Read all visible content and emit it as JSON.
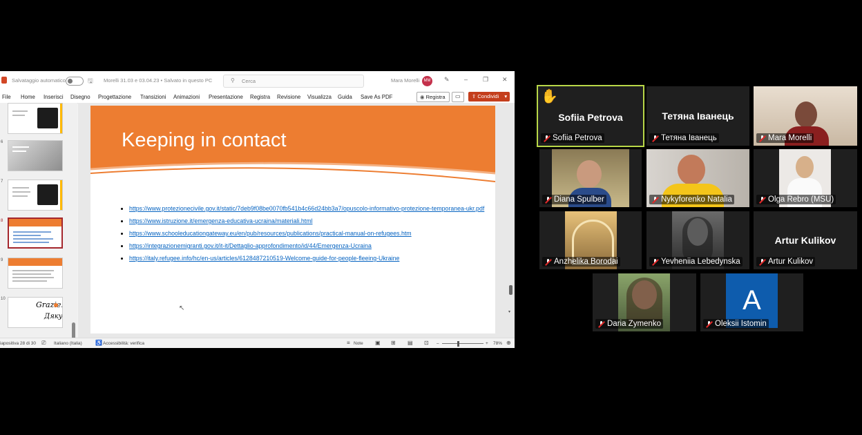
{
  "powerpoint": {
    "titlebar": {
      "autosave_label": "Salvataggio automatico",
      "file_title": "Morelli 31.03 e 03.04.23 • Salvato in questo PC",
      "search_placeholder": "Cerca",
      "user_name": "Mara Morelli",
      "user_initials": "MM"
    },
    "ribbon": {
      "tabs": [
        "File",
        "Home",
        "Inserisci",
        "Disegno",
        "Progettazione",
        "Transizioni",
        "Animazioni",
        "Presentazione",
        "Revisione",
        "Visualizza",
        "Guida",
        "Save As PDF"
      ],
      "record_label": "Registra",
      "share_label": "Condividi",
      "hidden_tab": "Registra"
    },
    "thumbnails": [
      {
        "number": "",
        "kind": "icon",
        "accent": "#ffb900"
      },
      {
        "number": "6",
        "kind": "image"
      },
      {
        "number": "7",
        "kind": "icon",
        "accent": "#ffb900"
      },
      {
        "number": "8",
        "kind": "links",
        "selected": true
      },
      {
        "number": "9",
        "kind": "references"
      },
      {
        "number": "10",
        "kind": "thanks"
      }
    ],
    "slide": {
      "title": "Keeping in contact",
      "links": [
        "https://www.protezionecivile.gov.it/static/7deb9f08be0070fb541b4c66d24bb3a7/opuscolo-informativo-protezione-temporanea-ukr.pdf",
        "https://www.istruzione.it/emergenza-educativa-ucraina/materiali.html",
        "https://www.schooleducationgateway.eu/en/pub/resources/publications/practical-manual-on-refugees.htm",
        "https://integrazionemigranti.gov.it/it-it/Dettaglio-approfondimento/id/44/Emergenza-Ucraina",
        "https://italy.refugee.info/hc/en-us/articles/6128487210519-Welcome-guide-for-people-fleeing-Ukraine"
      ],
      "accent_color": "#ed7d31"
    },
    "statusbar": {
      "slide_counter": "iapositiva 28 di 30",
      "language": "Italiano (Italia)",
      "accessibility": "Accessibilità: verifica",
      "notes_label": "Note",
      "zoom": "78%"
    }
  },
  "zoom_gallery": {
    "participants": [
      {
        "name": "Sofiia Petrova",
        "video": false,
        "hand_raised": true,
        "active_speaker": true
      },
      {
        "name": "Тетяна Іванець",
        "video": false
      },
      {
        "name": "Mara Morelli",
        "video": true
      },
      {
        "name": "Diana Spulber",
        "video": true
      },
      {
        "name": "Nykyforenko Natalia",
        "video": true
      },
      {
        "name": "Olga Rebro (MSU)",
        "video": true
      },
      {
        "name": "Anzhelika Borodai",
        "video": true
      },
      {
        "name": "Yevheniia Lebedynska",
        "video": true
      },
      {
        "name": "Artur Kulikov",
        "video": false
      },
      {
        "name": "Daria Zymenko",
        "video": true
      },
      {
        "name": "Oleksii Istomin",
        "video": false,
        "avatar_letter": "A"
      }
    ]
  }
}
